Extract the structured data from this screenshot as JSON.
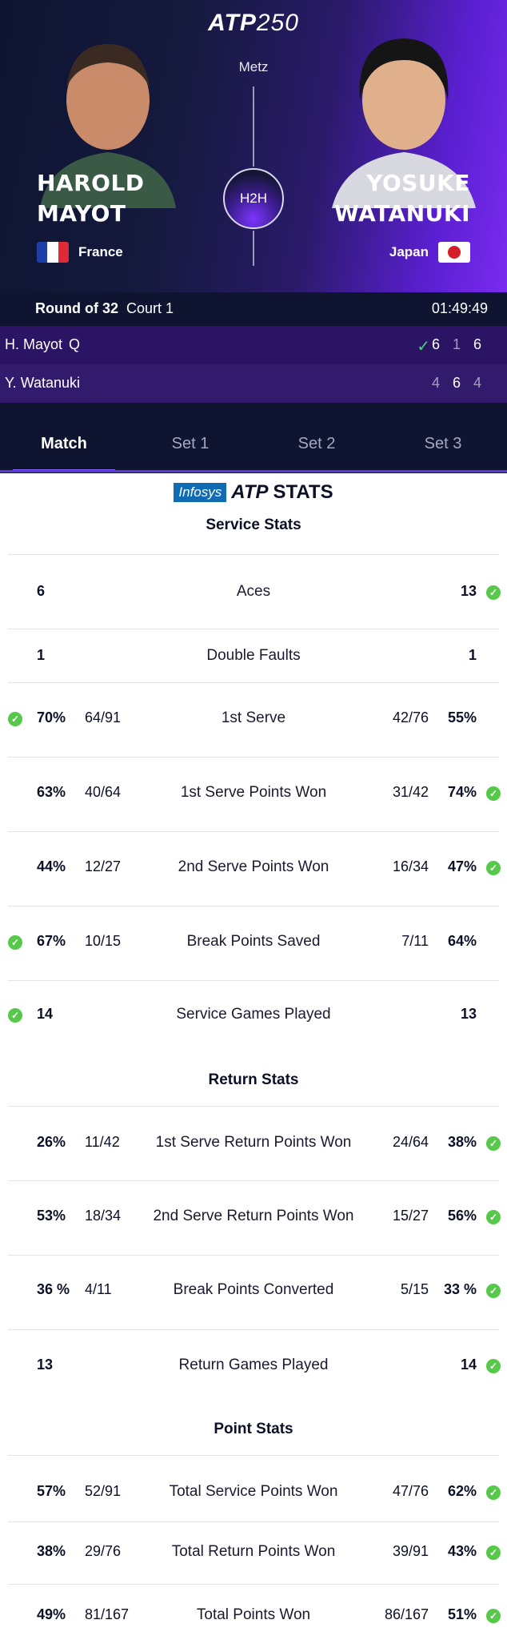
{
  "brand": {
    "atp": "ATP",
    "num": "250"
  },
  "event": {
    "city": "Metz",
    "h2h_label": "H2H"
  },
  "players": {
    "p1": {
      "first": "HAROLD",
      "last": "MAYOT",
      "country": "France"
    },
    "p2": {
      "first": "YOSUKE",
      "last": "WATANUKI",
      "country": "Japan"
    }
  },
  "match": {
    "round": "Round of 32",
    "court": "Court 1",
    "duration": "01:49:49"
  },
  "score": {
    "p1": {
      "name": "H. Mayot",
      "seed": "Q",
      "sets": [
        "6",
        "1",
        "6"
      ],
      "winner": true
    },
    "p2": {
      "name": "Y. Watanuki",
      "sets": [
        "4",
        "6",
        "4"
      ]
    }
  },
  "tabs": [
    "Match",
    "Set 1",
    "Set 2",
    "Set 3"
  ],
  "stats_header": {
    "infosys": "Infosys",
    "atp": "ATP",
    "stats": "STATS"
  },
  "sections": {
    "service": "Service Stats",
    "return": "Return Stats",
    "point": "Point Stats"
  },
  "service_stats": [
    {
      "label": "Aces",
      "p1": "6",
      "p2": "13",
      "p2_best": true
    },
    {
      "label": "Double Faults",
      "p1": "1",
      "p2": "1"
    },
    {
      "label": "1st Serve",
      "p1": "70%",
      "p1_frac": "64/91",
      "p2_frac": "42/76",
      "p2": "55%",
      "p1_best": true
    },
    {
      "label": "1st Serve Points Won",
      "p1": "63%",
      "p1_frac": "40/64",
      "p2_frac": "31/42",
      "p2": "74%",
      "p2_best": true
    },
    {
      "label": "2nd Serve Points Won",
      "p1": "44%",
      "p1_frac": "12/27",
      "p2_frac": "16/34",
      "p2": "47%",
      "p2_best": true
    },
    {
      "label": "Break Points Saved",
      "p1": "67%",
      "p1_frac": "10/15",
      "p2_frac": "7/11",
      "p2": "64%",
      "p1_best": true
    },
    {
      "label": "Service Games Played",
      "p1": "14",
      "p2": "13",
      "p1_best": true
    }
  ],
  "return_stats": [
    {
      "label": "1st Serve Return Points Won",
      "p1": "26%",
      "p1_frac": "11/42",
      "p2_frac": "24/64",
      "p2": "38%",
      "p2_best": true
    },
    {
      "label": "2nd Serve Return Points Won",
      "p1": "53%",
      "p1_frac": "18/34",
      "p2_frac": "15/27",
      "p2": "56%",
      "p2_best": true
    },
    {
      "label": "Break Points Converted",
      "p1": "36 %",
      "p1_frac": "4/11",
      "p2_frac": "5/15",
      "p2": "33 %",
      "p2_best": true
    },
    {
      "label": "Return Games Played",
      "p1": "13",
      "p2": "14",
      "p2_best": true
    }
  ],
  "point_stats": [
    {
      "label": "Total Service Points Won",
      "p1": "57%",
      "p1_frac": "52/91",
      "p2_frac": "47/76",
      "p2": "62%",
      "p2_best": true
    },
    {
      "label": "Total Return Points Won",
      "p1": "38%",
      "p1_frac": "29/76",
      "p2_frac": "39/91",
      "p2": "43%",
      "p2_best": true
    },
    {
      "label": "Total Points Won",
      "p1": "49%",
      "p1_frac": "81/167",
      "p2_frac": "86/167",
      "p2": "51%",
      "p2_best": true
    }
  ],
  "colors": {
    "accent": "#7a5cff",
    "check": "#56c84a",
    "win_check": "#47d27a"
  }
}
